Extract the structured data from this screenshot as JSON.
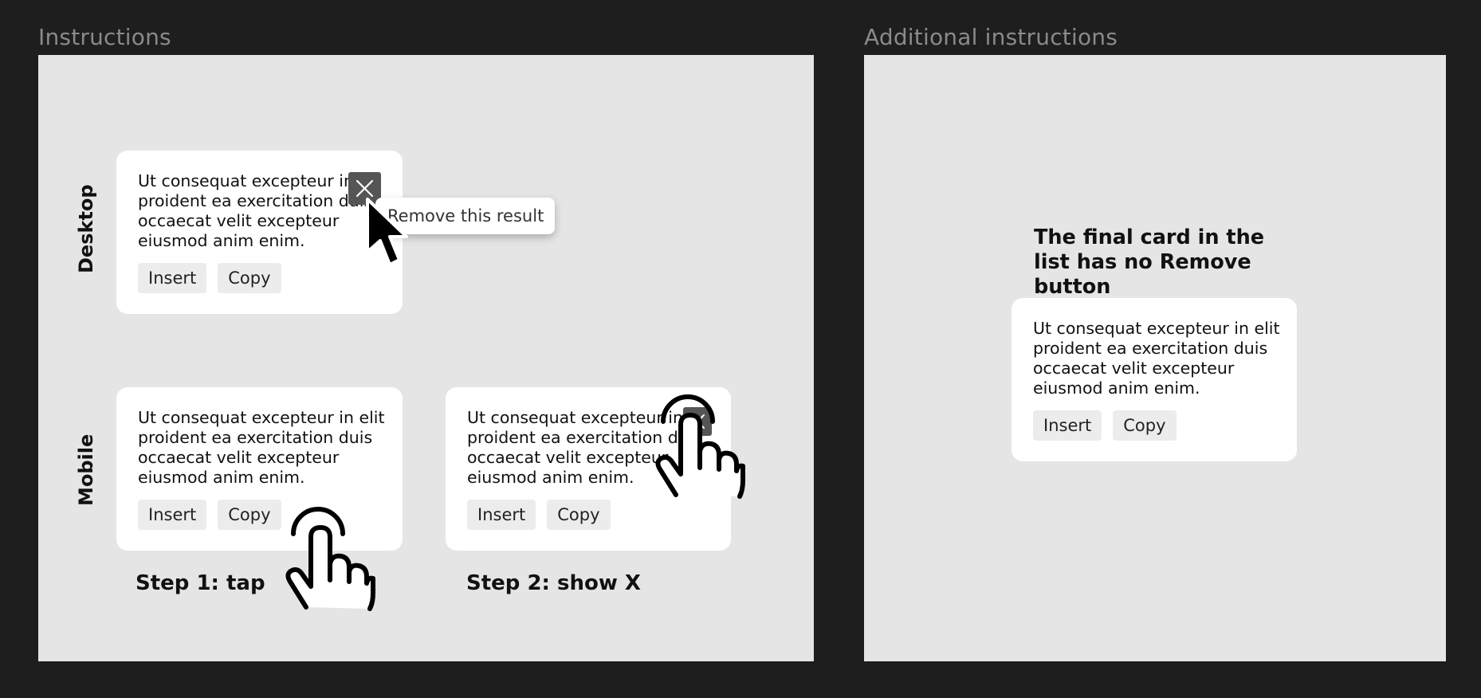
{
  "frames": {
    "instructions_title": "Instructions",
    "additional_title": "Additional instructions"
  },
  "labels": {
    "desktop": "Desktop",
    "mobile": "Mobile",
    "step1": "Step 1: tap",
    "step2": "Step 2: show X"
  },
  "card": {
    "text": "Ut consequat excepteur in elit proident ea exercitation duis occaecat velit excepteur eiusmod anim enim.",
    "insert_label": "Insert",
    "copy_label": "Copy"
  },
  "tooltip": {
    "text": "Remove this result"
  },
  "additional": {
    "heading": "The final card in the list has no Remove button"
  },
  "icons": {
    "close": "close-icon",
    "cursor": "mouse-pointer-icon",
    "hand": "tap-hand-icon"
  },
  "colors": {
    "background": "#1e1e1e",
    "panel": "#e5e5e5",
    "card": "#ffffff",
    "button": "#ececec",
    "close_button": "#555555",
    "frame_title": "#8a8a8a"
  }
}
